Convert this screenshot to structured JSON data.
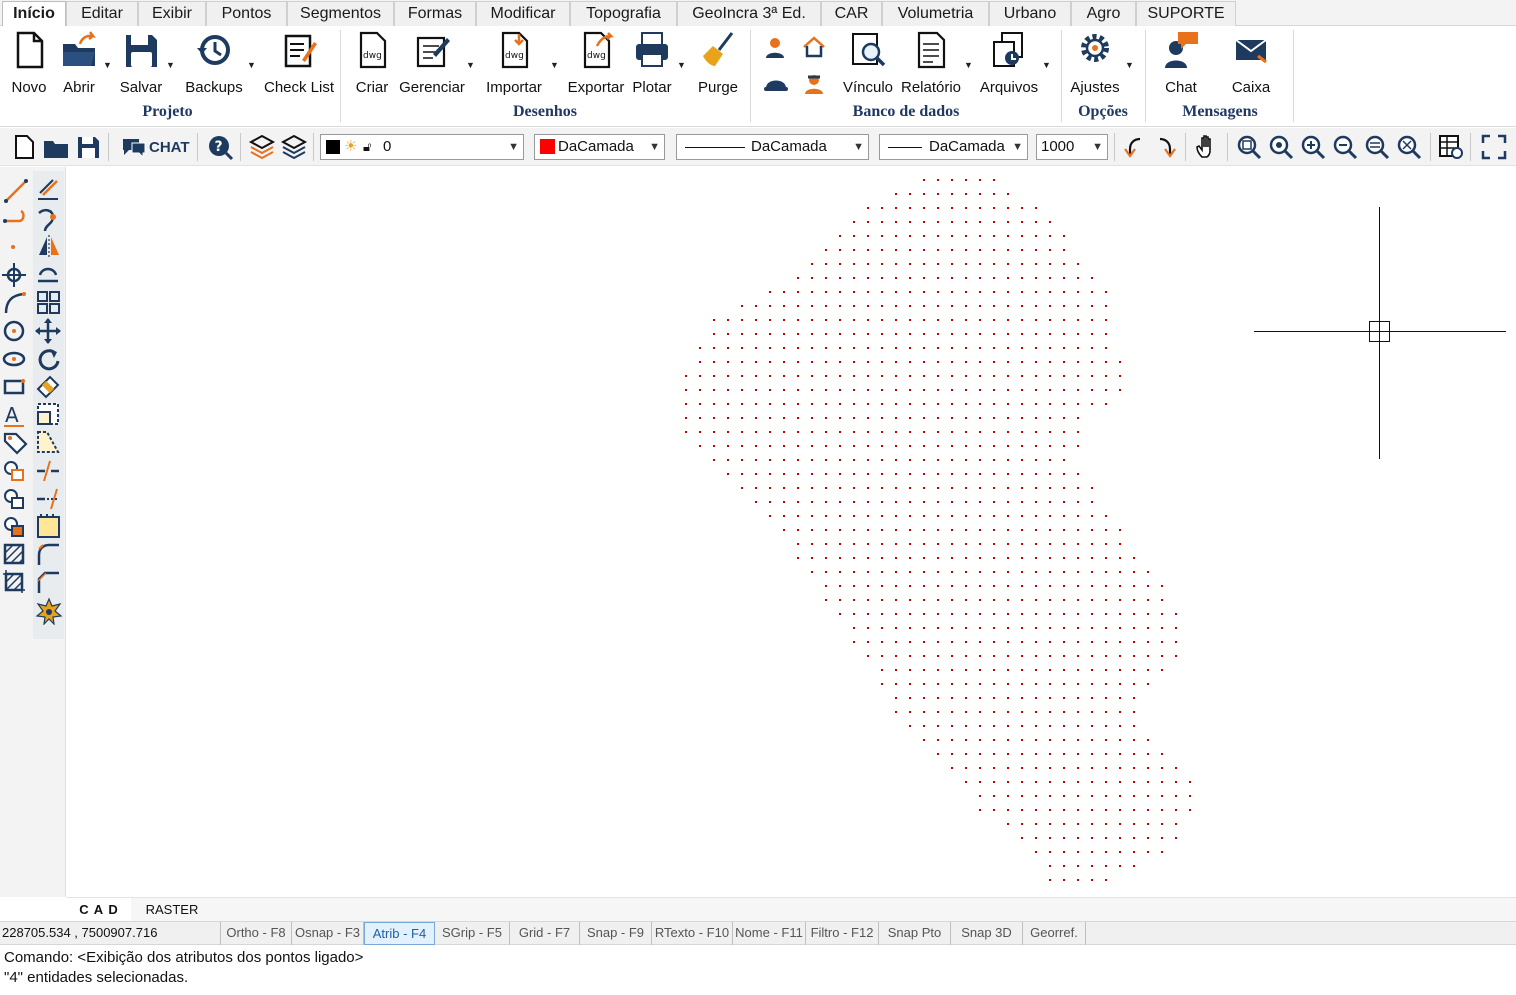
{
  "menu": {
    "tabs": [
      "Início",
      "Editar",
      "Exibir",
      "Pontos",
      "Segmentos",
      "Formas",
      "Modificar",
      "Topografia",
      "GeoIncra 3ª Ed.",
      "CAR",
      "Volumetria",
      "Urbano",
      "Agro",
      "SUPORTE"
    ],
    "active": "Início"
  },
  "ribbon": {
    "buttons": {
      "novo": "Novo",
      "abrir": "Abrir",
      "salvar": "Salvar",
      "backups": "Backups",
      "checklist": "Check List",
      "criar": "Criar",
      "gerenciar": "Gerenciar",
      "importar": "Importar",
      "exportar": "Exportar",
      "plotar": "Plotar",
      "purge": "Purge",
      "vinculo": "Vínculo",
      "relatorio": "Relatório",
      "arquivos": "Arquivos",
      "ajustes": "Ajustes",
      "chat": "Chat",
      "caixa": "Caixa"
    },
    "groups": {
      "projeto": "Projeto",
      "desenhos": "Desenhos",
      "banco": "Banco de dados",
      "opcoes": "Opções",
      "mensagens": "Mensagens"
    }
  },
  "toolbar": {
    "chat_label": "CHAT",
    "layer_value": "0",
    "color_value": "DaCamada",
    "linetype_value": "DaCamada",
    "lineweight_value": "DaCamada",
    "scale_value": "1000"
  },
  "colors": {
    "accent": "#1f3864",
    "points": "#c00000",
    "color_swatch": "#ff0000"
  },
  "cad_tabs": {
    "cad": "C A D",
    "raster": "RASTER"
  },
  "status": {
    "coordinates": "228705.534 , 7500907.716",
    "toggles": [
      "Ortho - F8",
      "Osnap - F3",
      "Atrib - F4",
      "SGrip - F5",
      "Grid - F7",
      "Snap - F9",
      "RTexto - F10",
      "Nome - F11",
      "Filtro - F12",
      "Snap Pto",
      "Snap 3D",
      "Georref."
    ],
    "active_toggle": "Atrib - F4"
  },
  "command": {
    "line1": "Comando: <Exibição dos atributos dos pontos ligado>",
    "line2": "\"4\" entidades selecionadas."
  }
}
